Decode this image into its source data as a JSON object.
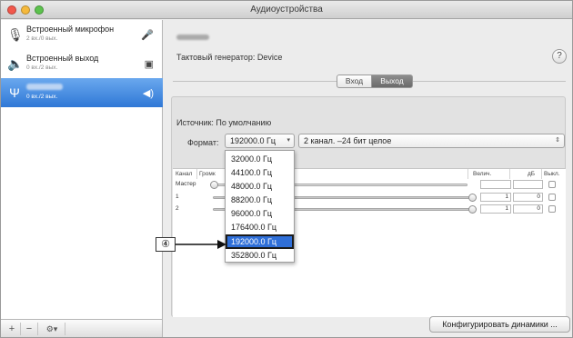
{
  "window": {
    "title": "Аудиоустройства"
  },
  "sidebar": {
    "devices": [
      {
        "name": "Встроенный микрофон",
        "sub": "2 вх./0 вых.",
        "icon": "microphone-icon",
        "badge": "mic-badge-icon"
      },
      {
        "name": "Встроенный выход",
        "sub": "0 вх./2 вых.",
        "icon": "speaker-icon",
        "badge": "display-badge-icon"
      },
      {
        "name": "",
        "sub": "0 вх./2 вых.",
        "icon": "usb-icon",
        "badge": "speaker-badge-icon"
      }
    ],
    "bottom": {
      "add": "+",
      "remove": "−",
      "gear": "⚙▾"
    }
  },
  "main": {
    "clock_source": "Тактовый генератор: Device",
    "help": "?",
    "tabs": [
      {
        "label": "Вход"
      },
      {
        "label": "Выход"
      }
    ],
    "source_label": "Источник: По умолчанию",
    "format_label": "Формат:",
    "format_rate": "192000.0 Гц",
    "format_channels": "2 канал. –24 бит целое",
    "table": {
      "headers": {
        "channel": "Канал",
        "volume": "Громк",
        "value": "Велич.",
        "db": "дБ",
        "mute": "Выкл."
      },
      "rows": [
        {
          "name": "Мастер",
          "value": "",
          "db": ""
        },
        {
          "name": "1",
          "value": "1",
          "db": "0"
        },
        {
          "name": "2",
          "value": "1",
          "db": "0"
        }
      ]
    },
    "configure_button": "Конфигурировать динамики ..."
  },
  "dropdown": {
    "options": [
      "32000.0 Гц",
      "44100.0 Гц",
      "48000.0 Гц",
      "88200.0 Гц",
      "96000.0 Гц",
      "176400.0 Гц",
      "192000.0 Гц",
      "352800.0 Гц"
    ],
    "selected": "192000.0 Гц"
  },
  "callout": {
    "label": "④"
  },
  "colors": {
    "selection": "#2f78d6",
    "highlight": "#2f6fd8",
    "close": "#f2574b",
    "minimize": "#f5b93c",
    "zoom": "#5cc24d"
  }
}
